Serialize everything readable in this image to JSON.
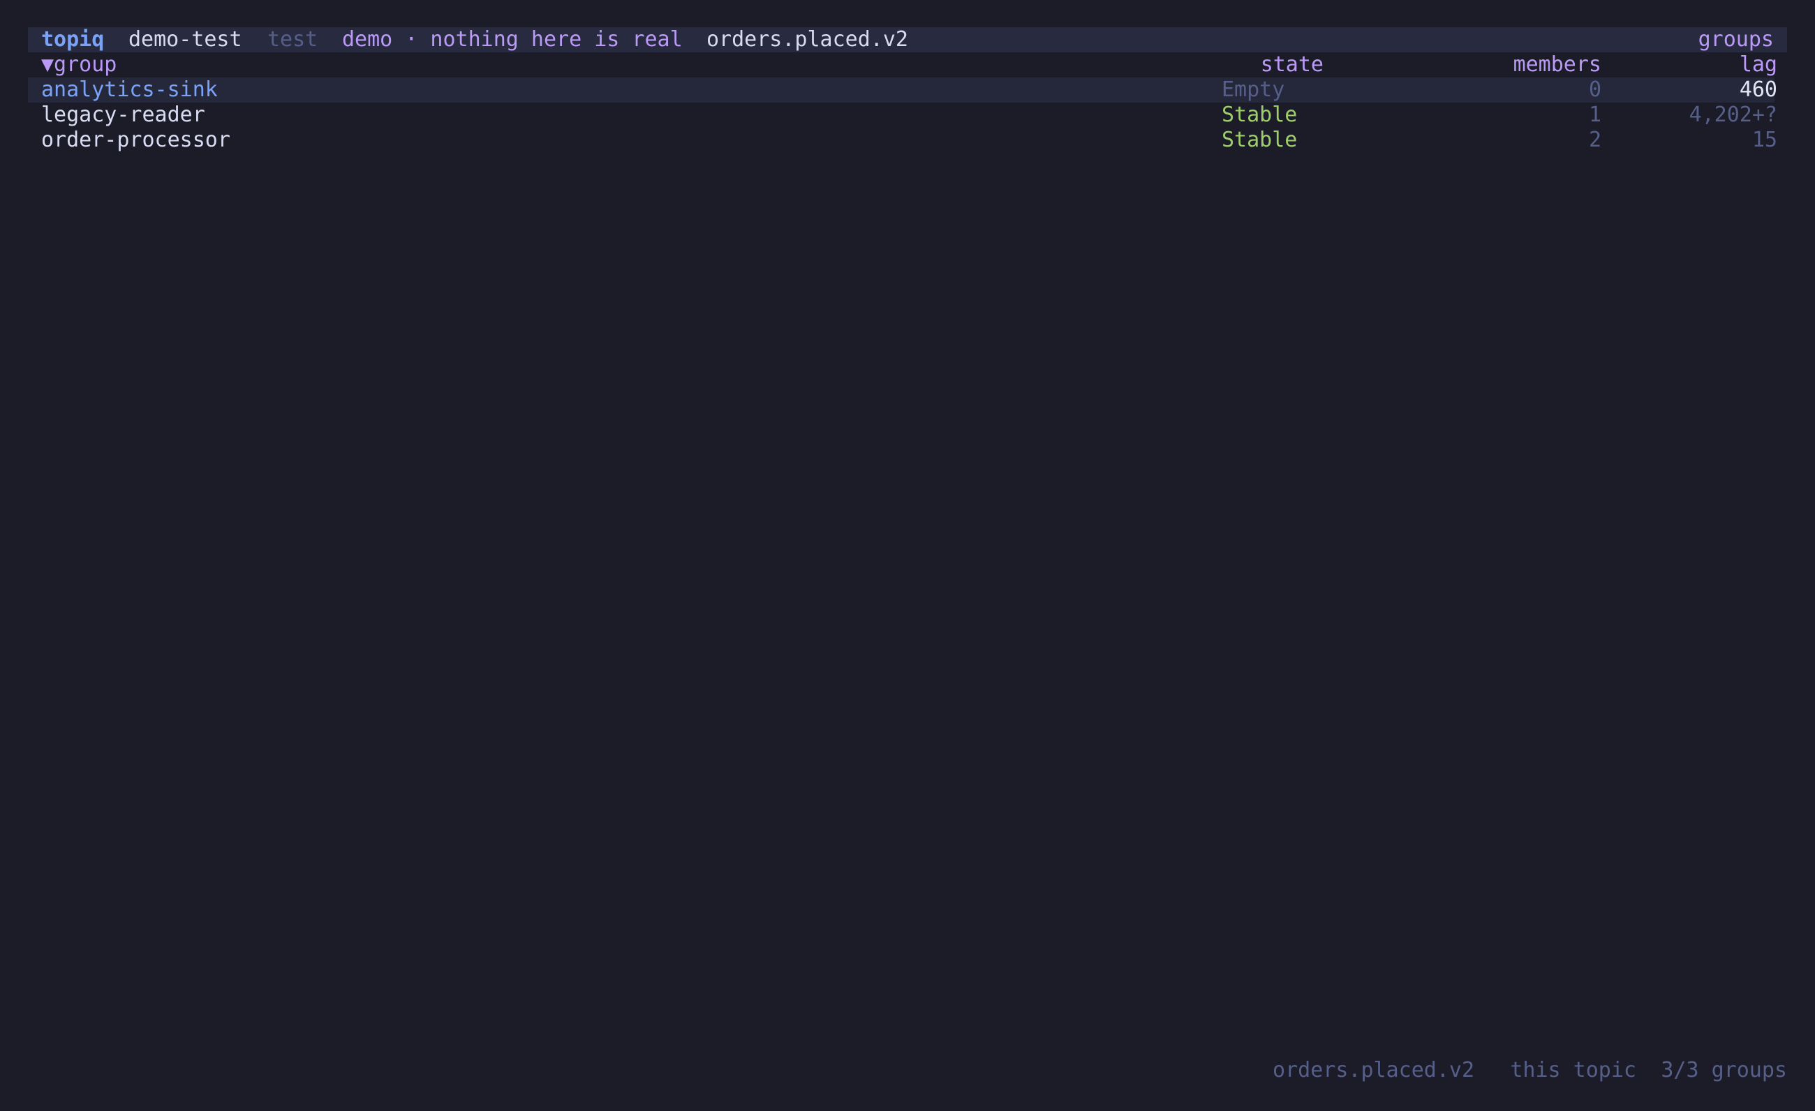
{
  "header": {
    "app_name": "topiq",
    "cluster": "demo-test",
    "environment": "test",
    "banner": "demo · nothing here is real",
    "topic": "orders.placed.v2",
    "view": "groups"
  },
  "table": {
    "columns": {
      "group": "▼group",
      "state": "state",
      "members": "members",
      "lag": "lag"
    },
    "sort_indicator": "▼",
    "rows": [
      {
        "group": "analytics-sink",
        "state": "Empty",
        "members": "0",
        "lag": "460",
        "selected": true
      },
      {
        "group": "legacy-reader",
        "state": "Stable",
        "members": "1",
        "lag": "4,202+?",
        "selected": false
      },
      {
        "group": "order-processor",
        "state": "Stable",
        "members": "2",
        "lag": "15",
        "selected": false
      }
    ]
  },
  "footer": {
    "topic": "orders.placed.v2",
    "scope": "this topic",
    "count": "3/3 groups"
  },
  "colors": {
    "background": "#1c1c28",
    "topbar": "#282b3f",
    "selected_row": "#25283a",
    "accent_blue": "#7aa2f7",
    "accent_purple": "#bb9af7",
    "stable_green": "#9ece6a",
    "muted": "#565f89"
  }
}
